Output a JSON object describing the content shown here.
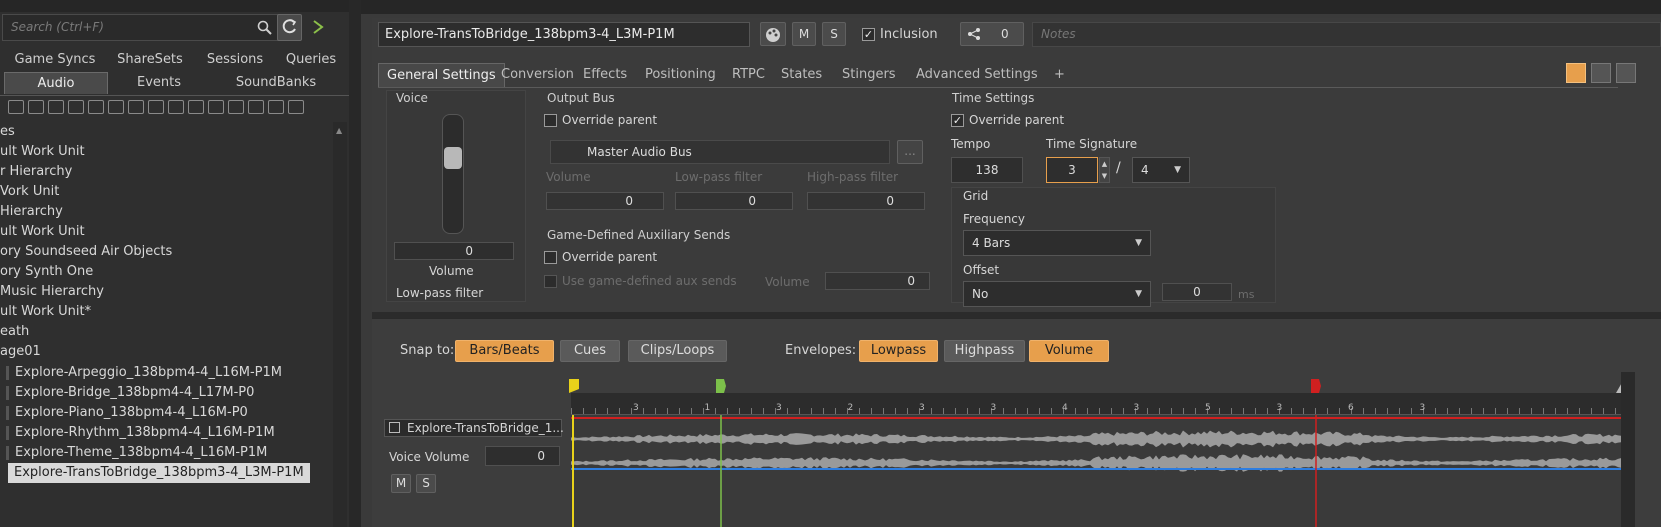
{
  "left": {
    "search_placeholder": "Search (Ctrl+F)",
    "tabs_row1": [
      "Game Syncs",
      "ShareSets",
      "Sessions",
      "Queries"
    ],
    "tabs_row2": [
      "Audio",
      "Events",
      "SoundBanks"
    ],
    "tree": [
      "es",
      "ult Work Unit",
      "r Hierarchy",
      "Vork Unit",
      " Hierarchy",
      "ult Work Unit",
      "ory Soundseed Air Objects",
      "ory Synth One",
      "Music Hierarchy",
      "ult Work Unit*",
      "eath",
      "age01",
      "Explore-Arpeggio_138bpm4-4_L16M-P1M",
      "Explore-Bridge_138bpm4-4_L17M-P0",
      "Explore-Piano_138bpm4-4_L16M-P0",
      "Explore-Rhythm_138bpm4-4_L16M-P1M",
      "Explore-Theme_138bpm4-4_L16M-P1M",
      "Explore-TransToBridge_138bpm3-4_L3M-P1M"
    ]
  },
  "header": {
    "object_name": "Explore-TransToBridge_138bpm3-4_L3M-P1M",
    "mute": "M",
    "solo": "S",
    "inclusion": "Inclusion",
    "share_count": "0",
    "notes_placeholder": "Notes"
  },
  "tabs": [
    "General Settings",
    "Conversion",
    "Effects",
    "Positioning",
    "RTPC",
    "States",
    "Stingers",
    "Advanced Settings",
    "+"
  ],
  "voice": {
    "title": "Voice",
    "volume_value": "0",
    "volume_label": "Volume",
    "lowpass_label": "Low-pass filter"
  },
  "output_bus": {
    "title": "Output Bus",
    "override": "Override parent",
    "bus_name": "Master Audio Bus",
    "more": "...",
    "volume": "Volume",
    "lowpass": "Low-pass filter",
    "highpass": "High-pass filter",
    "v1": "0",
    "v2": "0",
    "v3": "0"
  },
  "aux": {
    "title": "Game-Defined Auxiliary Sends",
    "override": "Override parent",
    "use": "Use game-defined aux sends",
    "volume": "Volume",
    "value": "0"
  },
  "time": {
    "title": "Time Settings",
    "override": "Override parent",
    "tempo_label": "Tempo",
    "tempo": "138",
    "sig_label": "Time Signature",
    "sig_num": "3",
    "slash": "/",
    "sig_den": "4",
    "grid": "Grid",
    "freq_label": "Frequency",
    "freq": "4 Bars",
    "offset_label": "Offset",
    "offset": "No",
    "offset_value": "0",
    "ms": "ms"
  },
  "lower": {
    "snap_label": "Snap to:",
    "snap": [
      "Bars/Beats",
      "Cues",
      "Clips/Loops"
    ],
    "snap_on": [
      true,
      false,
      false
    ],
    "env_label": "Envelopes:",
    "env": [
      "Lowpass",
      "Highpass",
      "Volume"
    ],
    "env_on": [
      true,
      false,
      true
    ],
    "track_name": "Explore-TransToBridge_1...",
    "voice_volume": "Voice Volume",
    "voice_volume_value": "0",
    "m": "M",
    "s": "S",
    "ruler_nums": [
      "3",
      "1",
      "3",
      "2",
      "3",
      "3",
      "4",
      "3",
      "5",
      "3",
      "6",
      "3"
    ],
    "clip_label": "Explore-TransToBridge_138bpm3-4_L3M-P1M"
  },
  "colors": {
    "accent": "#e79f4c",
    "red_line": "#d02020",
    "blue_line": "#2d7de0",
    "green_marker": "#7cc04a",
    "yellow_marker": "#e8d21a"
  }
}
